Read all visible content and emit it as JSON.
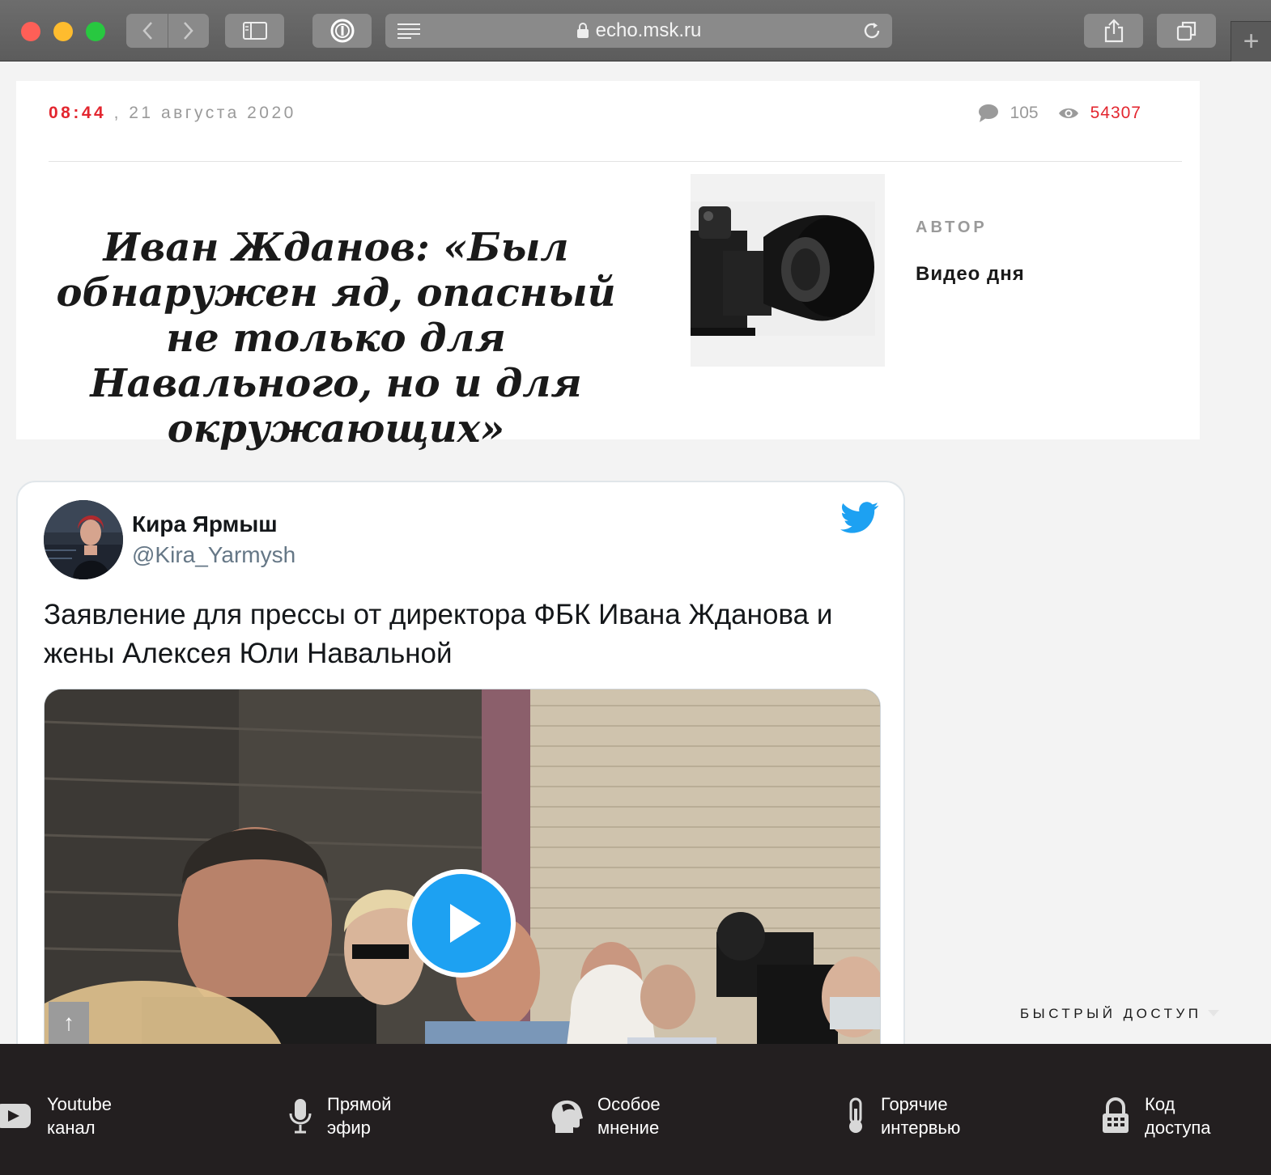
{
  "browser": {
    "url": "echo.msk.ru"
  },
  "article": {
    "time": "08:44",
    "separator": ",",
    "date": "21 августа 2020",
    "comments_count": "105",
    "views_count": "54307",
    "headline": "Иван Жданов: «Был обнаружен яд, опасный не только для Навального, но и для окружающих»",
    "author_label": "АВТОР",
    "author_name": "Видео дня"
  },
  "tweet": {
    "author_name": "Кира Ярмыш",
    "handle": "@Kira_Yarmysh",
    "text": "Заявление для прессы от директора ФБК Ивана Жданова и жены Алексея Юли Навальной",
    "media_type": "video"
  },
  "quick_access": {
    "label": "БЫСТРЫЙ ДОСТУП"
  },
  "footer": {
    "items": [
      {
        "icon": "youtube-icon",
        "label": "Youtube\nканал"
      },
      {
        "icon": "microphone-icon",
        "label": "Прямой\nэфир"
      },
      {
        "icon": "head-profile-icon",
        "label": "Особое\nмнение"
      },
      {
        "icon": "thermometer-icon",
        "label": "Горячие\nинтервью"
      },
      {
        "icon": "padlock-icon",
        "label": "Код\nдоступа"
      }
    ]
  },
  "colors": {
    "accent_red": "#e3262f",
    "twitter_blue": "#1da1f2",
    "footer_bg": "#231f20"
  }
}
